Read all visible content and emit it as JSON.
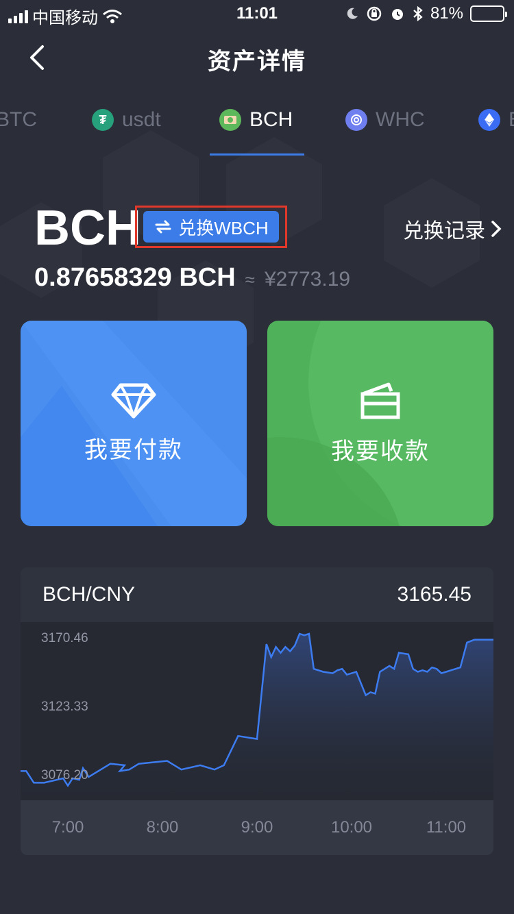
{
  "status_bar": {
    "carrier": "中国移动",
    "time": "11:01",
    "battery": "81%",
    "battery_level": 0.81
  },
  "nav": {
    "title": "资产详情"
  },
  "tabs": [
    {
      "label": "BTC",
      "active": false,
      "icon": "btc-icon"
    },
    {
      "label": "usdt",
      "active": false,
      "icon": "tether-icon",
      "color": "#26a17b"
    },
    {
      "label": "BCH",
      "active": true,
      "icon": "bch-icon",
      "color": "#5db75b"
    },
    {
      "label": "WHC",
      "active": false,
      "icon": "whc-icon",
      "color": "#6f7ff0"
    },
    {
      "label": "E",
      "active": false,
      "icon": "eth-icon",
      "color": "#3a6cf4"
    }
  ],
  "balance": {
    "coin": "BCH",
    "exchange_label": "兑换WBCH",
    "exchange_record_label": "兑换记录",
    "amount": "0.87658329 BCH",
    "approx": "≈",
    "cny_value": "¥2773.19"
  },
  "actions": {
    "pay_label": "我要付款",
    "receive_label": "我要收款"
  },
  "price_chart": {
    "pair": "BCH/CNY",
    "current_price": "3165.45"
  },
  "chart_data": {
    "type": "area",
    "ytick_labels": [
      "3170.46",
      "3123.33",
      "3076.20"
    ],
    "ytick_values": [
      3170.46,
      3123.33,
      3076.2
    ],
    "xtick_labels": [
      "7:00",
      "8:00",
      "9:00",
      "10:00",
      "11:00"
    ],
    "xtick_positions": [
      0.5,
      1.5,
      2.5,
      3.5,
      4.5
    ],
    "xlim": [
      0,
      5
    ],
    "ylim": [
      3060,
      3182
    ],
    "x": [
      0.0,
      0.06,
      0.14,
      0.25,
      0.45,
      0.5,
      0.55,
      0.62,
      0.66,
      0.72,
      0.95,
      1.1,
      1.05,
      1.15,
      1.25,
      1.55,
      1.7,
      1.9,
      2.05,
      2.15,
      2.3,
      2.5,
      2.6,
      2.65,
      2.7,
      2.75,
      2.8,
      2.85,
      2.9,
      2.95,
      3.0,
      3.05,
      3.1,
      3.2,
      3.3,
      3.35,
      3.4,
      3.45,
      3.55,
      3.65,
      3.7,
      3.75,
      3.8,
      3.85,
      3.9,
      3.95,
      4.0,
      4.1,
      4.15,
      4.2,
      4.25,
      4.3,
      4.35,
      4.4,
      4.45,
      4.5,
      4.55,
      4.65,
      4.72,
      4.8,
      4.9,
      5.0
    ],
    "y": [
      3080,
      3080,
      3072,
      3072,
      3075,
      3070,
      3075,
      3074,
      3082,
      3076,
      3085,
      3084,
      3080,
      3081,
      3085,
      3087,
      3081,
      3084,
      3081,
      3084,
      3104,
      3102,
      3167,
      3158,
      3165,
      3161,
      3165,
      3162,
      3166,
      3174,
      3173,
      3174,
      3150,
      3148,
      3147,
      3149,
      3150,
      3146,
      3148,
      3132,
      3134,
      3133,
      3148,
      3150,
      3152,
      3150,
      3161,
      3160,
      3150,
      3148,
      3149,
      3148,
      3151,
      3150,
      3147,
      3148,
      3149,
      3151,
      3168,
      3170,
      3170,
      3170
    ]
  },
  "colors": {
    "accent": "#3b7ce8",
    "pay_card": "#4a8ff0",
    "receive_card": "#4fb159",
    "highlight_border": "#e0382b",
    "line": "#3c7cf0"
  }
}
